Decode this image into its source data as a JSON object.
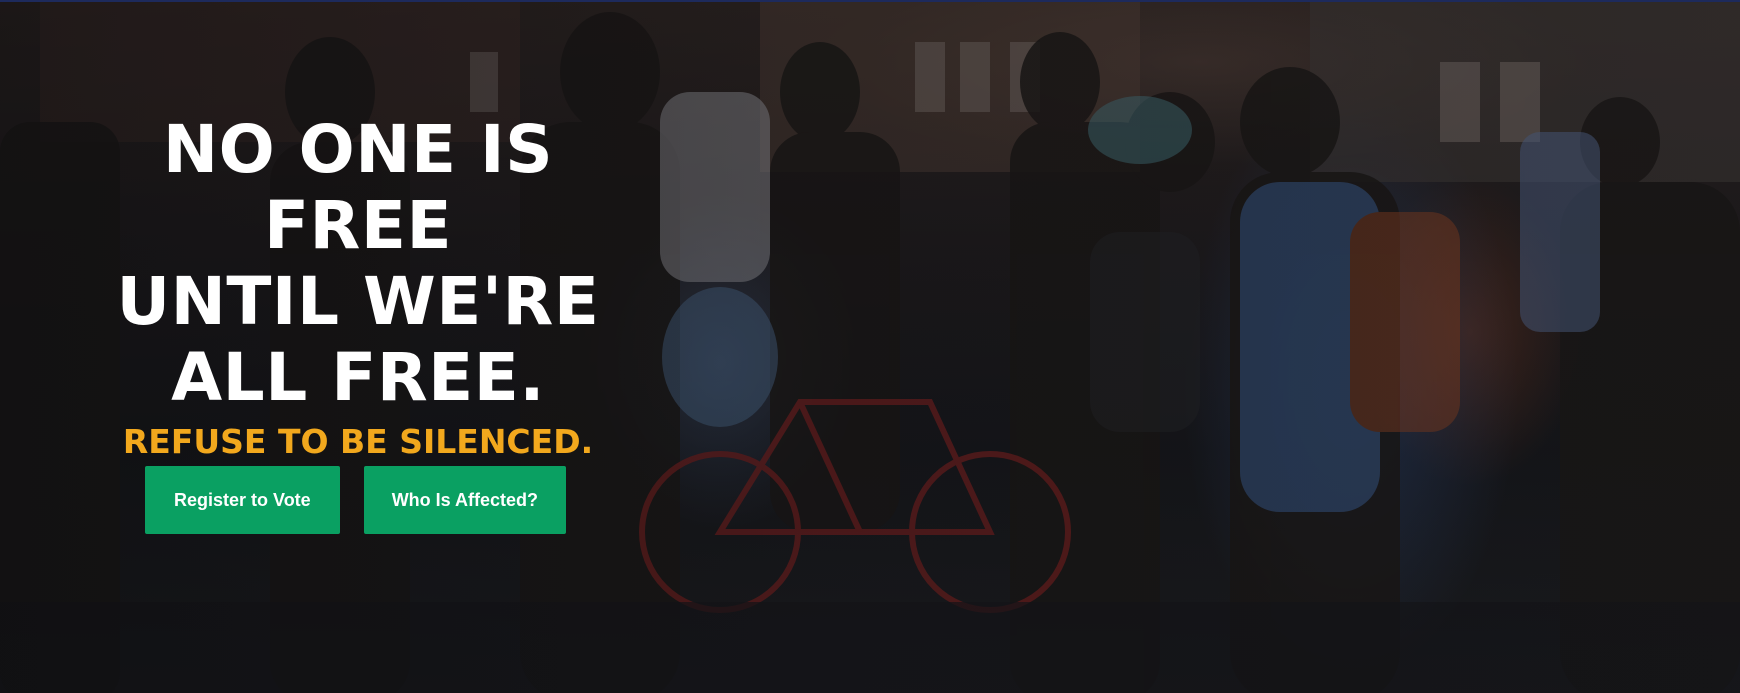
{
  "hero": {
    "headline_lines": [
      "NO ONE IS FREE",
      "UNTIL WE'RE",
      "ALL FREE."
    ],
    "subhead": "REFUSE TO BE SILENCED.",
    "background": "Photograph of masked protesters marching at dusk with a bicycle, apartment buildings behind",
    "colors": {
      "headline": "#ffffff",
      "subhead": "#f2a81d",
      "button_background": "#0aa062",
      "button_text": "#ffffff"
    }
  },
  "actions": {
    "register_label": "Register to Vote",
    "affected_label": "Who Is Affected?"
  }
}
